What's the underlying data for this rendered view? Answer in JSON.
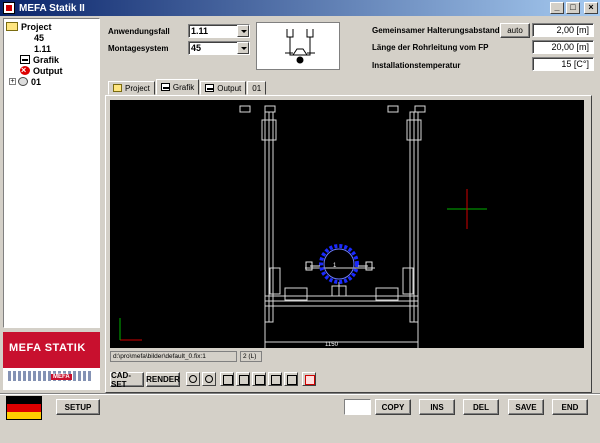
{
  "window": {
    "title": "MEFA Statik II",
    "minimize": "_",
    "maximize": "□",
    "close": "×"
  },
  "tree": {
    "project": "Project",
    "item_45": "45",
    "item_111": "1.11",
    "grafik": "Grafik",
    "output": "Output",
    "node_01": "01",
    "expander": "+"
  },
  "logo": {
    "brand": "MEFA STATIK",
    "badge": "MEFA"
  },
  "form": {
    "anwendungsfall_label": "Anwendungsfall",
    "anwendungsfall_value": "1.11",
    "montagesystem_label": "Montagesystem",
    "montagesystem_value": "45",
    "abstand_label": "Gemeinsamer Halterungsabstand",
    "auto_button": "auto",
    "abstand_value": "2,00 [m]",
    "laenge_label": "Länge der Rohrleitung vom FP",
    "laenge_value": "20,00 [m]",
    "temp_label": "Installationstemperatur",
    "temp_value": "15 [C°]"
  },
  "tabs": [
    {
      "label": "Project",
      "icon": "folder-icon"
    },
    {
      "label": "Grafik",
      "icon": "grafik-icon"
    },
    {
      "label": "Output",
      "icon": "output-icon"
    },
    {
      "label": "01",
      "icon": ""
    }
  ],
  "drawing": {
    "dimension": "1150",
    "pipe_label": "1",
    "status_path": "d:\\pro\\mefa\\bilder\\default_0.fix:1",
    "status_scale": "2 (L)"
  },
  "toolbar": {
    "cad_set": "CAD-SET",
    "render": "RENDER"
  },
  "bottom": {
    "setup": "SETUP",
    "copy": "COPY",
    "ins": "INS",
    "del": "DEL",
    "save": "SAVE",
    "end": "END"
  },
  "colors": {
    "flag_black": "#000000",
    "flag_red": "#dd0000",
    "flag_gold": "#ffcc00",
    "pipe": "#1a2aff",
    "crosshair_green": "#00b000",
    "crosshair_red": "#d00000"
  }
}
